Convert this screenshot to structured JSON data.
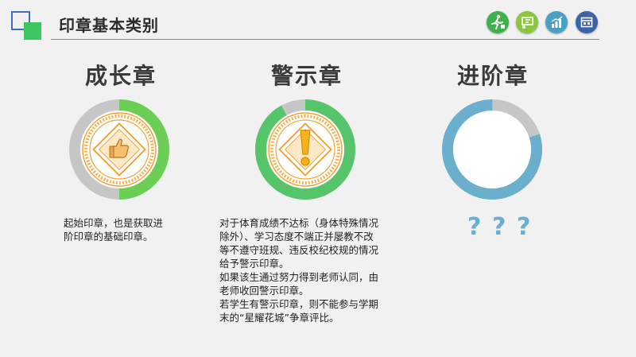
{
  "header": {
    "title": "印章基本类别",
    "icons": [
      "runner-icon",
      "classroom-icon",
      "chart-icon",
      "calendar-icon"
    ],
    "icon_colors": [
      "#3cb34a",
      "#8cc63f",
      "#4a9fc4",
      "#3b64a8"
    ]
  },
  "columns": [
    {
      "title": "成长章",
      "icon": "thumbs-up-icon",
      "ring_color": "#6ccf55",
      "fill_fraction": 0.5,
      "lines": [
        "起始印章，也是获取进",
        "阶印章的基础印章。"
      ]
    },
    {
      "title": "警示章",
      "icon": "exclamation-icon",
      "ring_color": "#56c468",
      "fill_fraction": 0.92,
      "lines": [
        "对于体育成绩不达标（身体特殊情况",
        "除外）、学习态度不端正并屡教不改",
        "等不遵守班规、违反校纪校规的情况",
        "给予警示印章。",
        "如果该生通过努力得到老师认同，由",
        "老师收回警示印章。",
        "若学生有警示印章，则不能参与学期",
        "末的“星耀花城”争章评比。"
      ]
    },
    {
      "title": "进阶章",
      "ring_color": "#6ab0cd",
      "fill_fraction": 0.8,
      "question_marks": [
        "?",
        "?",
        "?"
      ]
    }
  ]
}
